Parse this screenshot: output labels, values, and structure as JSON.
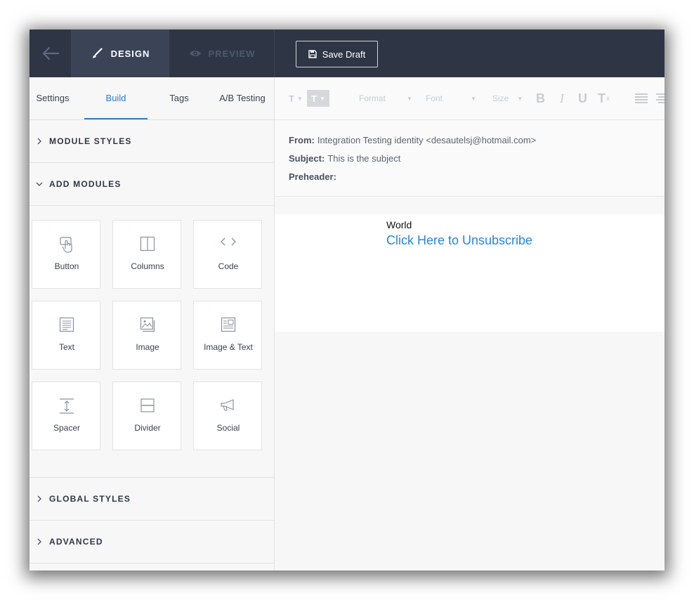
{
  "topbar": {
    "back_icon": "arrow-left-icon",
    "design_label": "DESIGN",
    "design_icon": "brush-icon",
    "preview_label": "PREVIEW",
    "preview_icon": "eye-icon",
    "save_label": "Save Draft",
    "save_icon": "floppy-disk-icon",
    "bg_color": "#2e3645"
  },
  "sidebar": {
    "tabs": [
      {
        "label": "Settings",
        "active": false
      },
      {
        "label": "Build",
        "active": true
      },
      {
        "label": "Tags",
        "active": false
      },
      {
        "label": "A/B Testing",
        "active": false
      }
    ],
    "sections": {
      "module_styles": "MODULE STYLES",
      "add_modules": "ADD MODULES",
      "global_styles": "GLOBAL STYLES",
      "advanced": "ADVANCED"
    },
    "modules": [
      {
        "label": "Button",
        "icon": "pointer-hand-icon"
      },
      {
        "label": "Columns",
        "icon": "columns-icon"
      },
      {
        "label": "Code",
        "icon": "code-brackets-icon"
      },
      {
        "label": "Text",
        "icon": "text-doc-icon"
      },
      {
        "label": "Image",
        "icon": "image-icon"
      },
      {
        "label": "Image & Text",
        "icon": "image-text-icon"
      },
      {
        "label": "Spacer",
        "icon": "spacer-icon"
      },
      {
        "label": "Divider",
        "icon": "divider-icon"
      },
      {
        "label": "Social",
        "icon": "megaphone-icon"
      }
    ]
  },
  "toolbar": {
    "text_style": "T",
    "text_color": "T",
    "format": "Format",
    "font": "Font",
    "size": "Size",
    "bold": "B",
    "italic": "I",
    "underline": "U",
    "clear_format": "T"
  },
  "email": {
    "from_label": "From:",
    "from_value": "Integration Testing identity <desautelsj@hotmail.com>",
    "subject_label": "Subject:",
    "subject_value": "This is the subject",
    "preheader_label": "Preheader:",
    "preheader_value": ""
  },
  "canvas": {
    "text": "World",
    "link": "Click Here to Unsubscribe",
    "link_color": "#2e86d6"
  },
  "accent_color": "#2e7cc7"
}
